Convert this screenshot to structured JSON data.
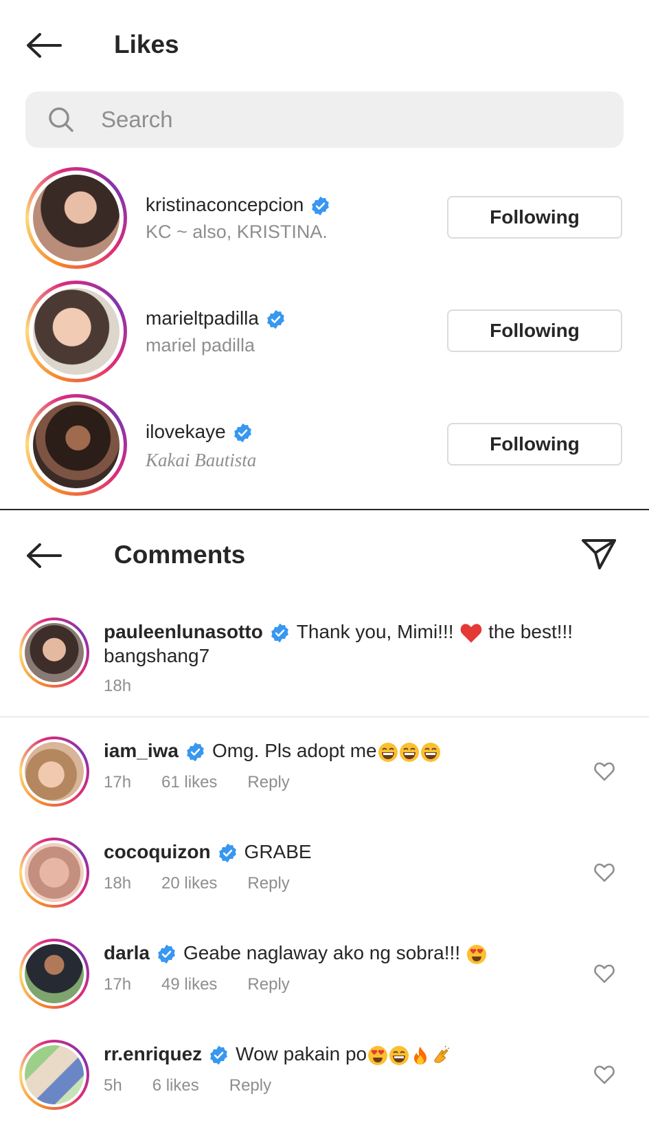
{
  "likes": {
    "title": "Likes",
    "search_placeholder": "Search",
    "users": [
      {
        "username": "kristinaconcepcion",
        "full_name": "KC ~ also, KRISTINA.",
        "button": "Following"
      },
      {
        "username": "marieltpadilla",
        "full_name": "mariel padilla",
        "button": "Following"
      },
      {
        "username": "ilovekaye",
        "full_name": "Kakai Bautista",
        "button": "Following"
      }
    ]
  },
  "comments": {
    "title": "Comments",
    "caption": {
      "username": "pauleenlunasotto",
      "text_before": "Thank you, Mimi!!!",
      "text_after": "the best!!!",
      "mention": "bangshang7",
      "time": "18h"
    },
    "items": [
      {
        "username": "iam_iwa",
        "text": "Omg. Pls adopt me",
        "time": "17h",
        "likes": "61 likes",
        "reply": "Reply"
      },
      {
        "username": "cocoquizon",
        "text": "GRABE",
        "time": "18h",
        "likes": "20 likes",
        "reply": "Reply"
      },
      {
        "username": "darla",
        "text": "Geabe naglaway ako ng sobra!!!",
        "time": "17h",
        "likes": "49 likes",
        "reply": "Reply"
      },
      {
        "username": "rr.enriquez",
        "text": "Wow pakain po",
        "time": "5h",
        "likes": "6 likes",
        "reply": "Reply"
      }
    ]
  },
  "colors": {
    "verified": "#3897f0",
    "muted": "#8e8e8e",
    "heart": "#ed4956"
  },
  "icons": [
    "back-arrow-icon",
    "search-icon",
    "verified-badge-icon",
    "send-icon",
    "heart-icon"
  ]
}
